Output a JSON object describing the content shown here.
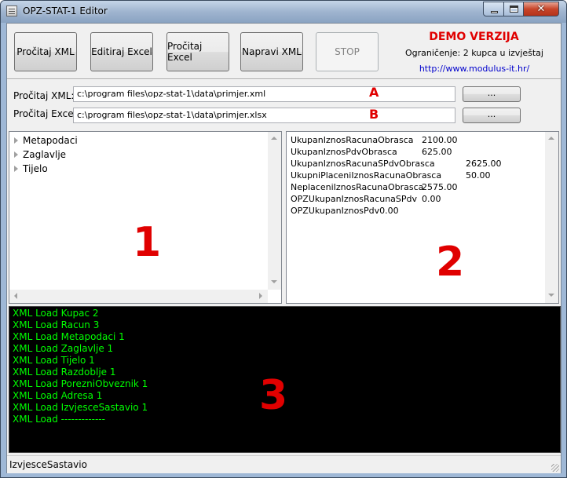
{
  "window": {
    "title": "OPZ-STAT-1 Editor",
    "close_glyph": "✕"
  },
  "toolbar": {
    "buttons": [
      {
        "label": "Pročitaj XML"
      },
      {
        "label": "Editiraj Excel"
      },
      {
        "label": "Pročitaj Excel"
      },
      {
        "label": "Napravi XML"
      },
      {
        "label": "STOP"
      }
    ]
  },
  "demo": {
    "title": "DEMO VERZIJA",
    "limit": "Ograničenje: 2 kupca u izvještaj",
    "link": "http://www.modulus-it.hr/"
  },
  "paths": {
    "xml_label": "Pročitaj XML:",
    "xml_value": "c:\\program files\\opz-stat-1\\data\\primjer.xml",
    "xml_tag": "A",
    "excel_label": "Pročitaj Excel:",
    "excel_value": "c:\\program files\\opz-stat-1\\data\\primjer.xlsx",
    "excel_tag": "B",
    "browse_label": "..."
  },
  "tree": {
    "items": [
      {
        "label": "Metapodaci"
      },
      {
        "label": "Zaglavlje"
      },
      {
        "label": "Tijelo"
      }
    ],
    "marker": "1"
  },
  "details": {
    "rows": [
      {
        "name": "UkupanIznosRacunaObrasca",
        "value": "2100.00"
      },
      {
        "name": "UkupanIznosPdvObrasca",
        "value": "625.00"
      },
      {
        "name": "UkupanIznosRacunaSPdvObrasca",
        "value": "2625.00"
      },
      {
        "name": "UkupniPlaceniIznosRacunaObrasca",
        "value": "50.00"
      },
      {
        "name": "NeplaceniIznosRacunaObrasca",
        "value": "2575.00"
      },
      {
        "name": "OPZUkupanIznosRacunaSPdv",
        "value": "0.00"
      },
      {
        "name": "OPZUkupanIznosPdv0.00",
        "value": ""
      }
    ],
    "marker": "2"
  },
  "log": {
    "lines": [
      "XML Load Kupac 2",
      "XML Load Racun 3",
      "XML Load Metapodaci 1",
      "XML Load Zaglavlje 1",
      "XML Load Tijelo 1",
      "XML Load Razdoblje 1",
      "XML Load PorezniObveznik 1",
      "XML Load Adresa 1",
      "XML Load IzvjesceSastavio 1",
      "XML Load -------------"
    ],
    "marker": "3"
  },
  "status": {
    "text": "IzvjesceSastavio"
  }
}
